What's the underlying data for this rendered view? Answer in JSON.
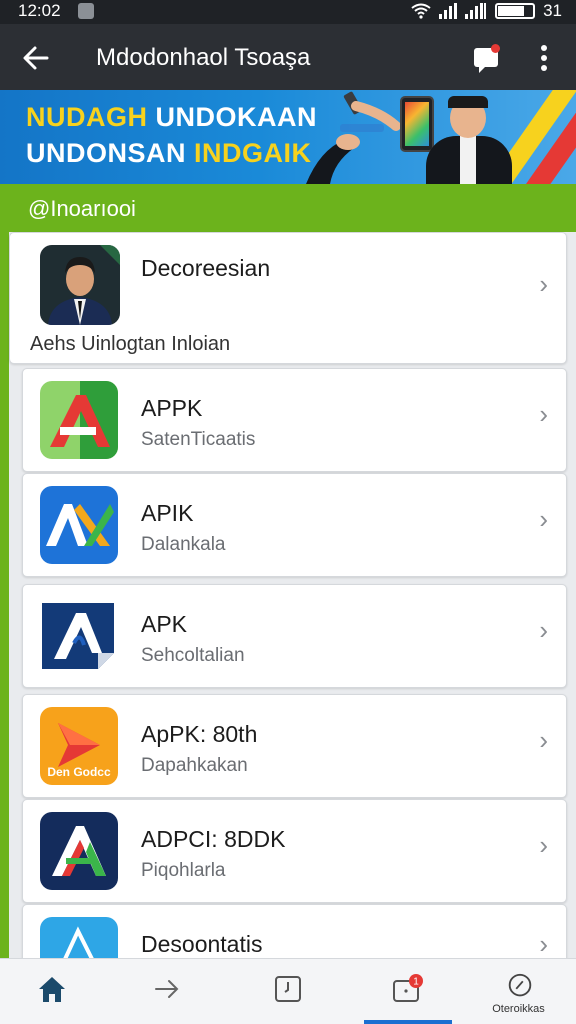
{
  "status_bar": {
    "time": "12:02",
    "battery_level": 0.75,
    "battery_text": "31"
  },
  "app_bar": {
    "title": "Mdodonhaol Tsoaşa",
    "back_icon": "arrow-left-icon",
    "chat_icon": "chat-bubble-icon",
    "more_icon": "more-vert-icon"
  },
  "banner": {
    "line1_a": "NUDAGH",
    "line1_b": "UNDOKAAN",
    "line2_a": "UNDONSAN",
    "line2_b": "INDGAIK"
  },
  "section": {
    "title": "@Inoarıooi"
  },
  "featured": {
    "title": "Decoreesian",
    "caption": "Aehs Uinlogtan Inloian"
  },
  "apps": [
    {
      "title": "APPK",
      "subtitle": "SatenTicaatis",
      "icon": "green-triangle-a-icon",
      "colors": [
        "#2f9e3a",
        "#e53935"
      ]
    },
    {
      "title": "APIK",
      "subtitle": "Dalankala",
      "icon": "blue-ax-logo-icon",
      "colors": [
        "#1e73d8",
        "#f2a81d"
      ]
    },
    {
      "title": "APK",
      "subtitle": "Sehcoltalian",
      "icon": "navy-a-sticker-icon",
      "colors": [
        "#133a78",
        "#1f5fbf"
      ]
    },
    {
      "title": "ApPK: 80th",
      "subtitle": "Dapahkakan",
      "icon": "orange-play-arrow-icon",
      "colors": [
        "#f7a21b",
        "#e53935"
      ],
      "icon_label": "Den Godcc"
    },
    {
      "title": "ADPCI: 8DDK",
      "subtitle": "Piqohlarla",
      "icon": "navy-tricolor-a-icon",
      "colors": [
        "#142c5c",
        "#e53935"
      ]
    },
    {
      "title": "Desoontatis",
      "subtitle": "",
      "icon": "cyan-a-outline-icon",
      "colors": [
        "#2ea6e6",
        "#ffffff"
      ]
    }
  ],
  "bottom_nav": [
    {
      "name": "home",
      "icon": "home-icon",
      "label": ""
    },
    {
      "name": "forward",
      "icon": "arrow-right-icon",
      "label": ""
    },
    {
      "name": "timer",
      "icon": "timer-icon",
      "label": ""
    },
    {
      "name": "messages",
      "icon": "message-badge-icon",
      "label": "",
      "badge": "1"
    },
    {
      "name": "search",
      "icon": "search-compass-icon",
      "label": "Oteroikkas"
    }
  ]
}
